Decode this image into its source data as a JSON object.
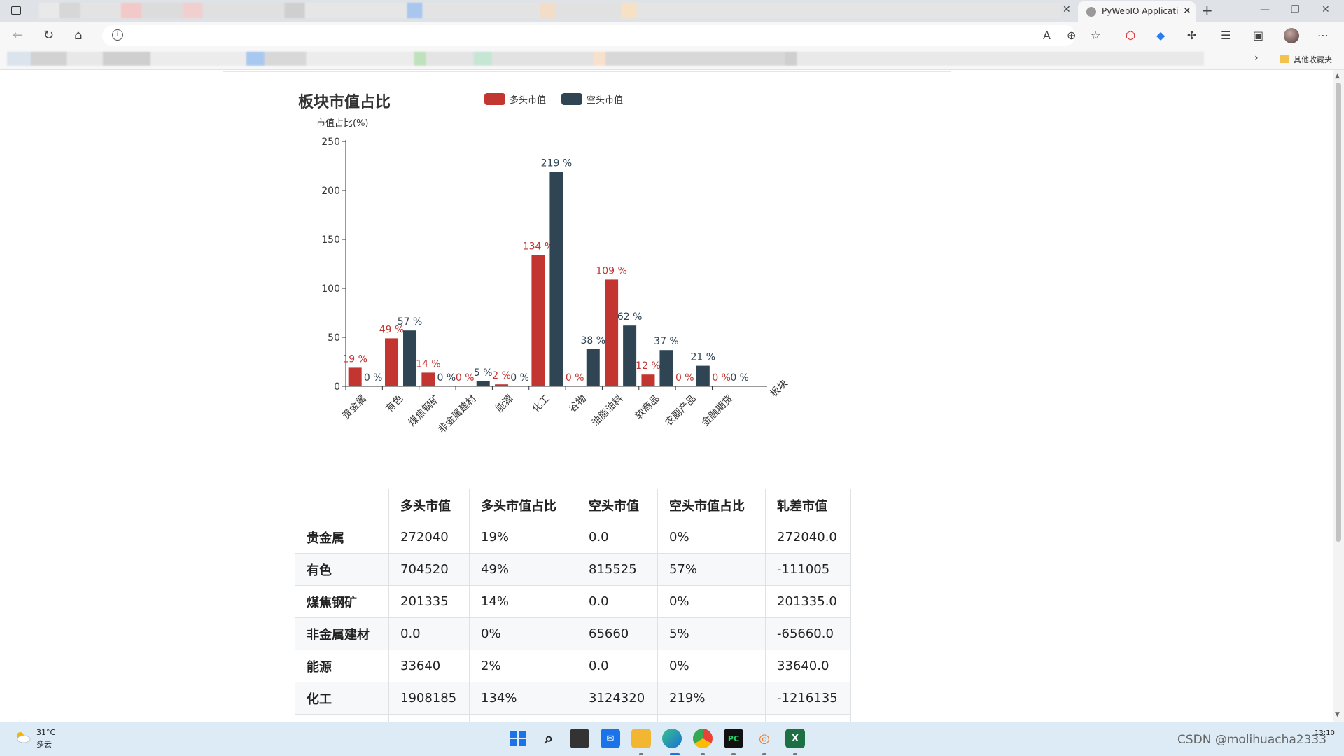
{
  "browser": {
    "active_tab_title": "PyWebIO Applicati",
    "new_tab_symbol": "+",
    "close_symbol": "✕",
    "bookmarks_folder": "其他收藏夹"
  },
  "chart": {
    "title": "板块市值占比",
    "legend": [
      {
        "name": "多头市值",
        "color": "#c23531"
      },
      {
        "name": "空头市值",
        "color": "#2f4554"
      }
    ]
  },
  "chart_data": {
    "type": "bar",
    "title": "板块市值占比",
    "ylabel": "市值占比(%)",
    "xlabel": "板块",
    "ylim": [
      0,
      250
    ],
    "yticks": [
      0,
      50,
      100,
      150,
      200,
      250
    ],
    "categories": [
      "贵金属",
      "有色",
      "煤焦钢矿",
      "非金属建材",
      "能源",
      "化工",
      "谷物",
      "油脂油料",
      "软商品",
      "农副产品",
      "金融期货"
    ],
    "series": [
      {
        "name": "多头市值",
        "color": "#c23531",
        "values": [
          19,
          49,
          14,
          0,
          2,
          134,
          0,
          109,
          12,
          0,
          0
        ]
      },
      {
        "name": "空头市值",
        "color": "#2f4554",
        "values": [
          0,
          57,
          0,
          5,
          0,
          219,
          38,
          62,
          37,
          21,
          0
        ]
      }
    ],
    "label_suffix": " %",
    "legend_position": "top"
  },
  "table": {
    "headers": [
      "",
      "多头市值",
      "多头市值占比",
      "空头市值",
      "空头市值占比",
      "轧差市值"
    ],
    "rows": [
      [
        "贵金属",
        "272040",
        "19%",
        "0.0",
        "0%",
        "272040.0"
      ],
      [
        "有色",
        "704520",
        "49%",
        "815525",
        "57%",
        "-111005"
      ],
      [
        "煤焦钢矿",
        "201335",
        "14%",
        "0.0",
        "0%",
        "201335.0"
      ],
      [
        "非金属建材",
        "0.0",
        "0%",
        "65660",
        "5%",
        "-65660.0"
      ],
      [
        "能源",
        "33640",
        "2%",
        "0.0",
        "0%",
        "33640.0"
      ],
      [
        "化工",
        "1908185",
        "134%",
        "3124320",
        "219%",
        "-1216135"
      ],
      [
        "",
        "",
        "",
        "",
        "",
        ""
      ]
    ]
  },
  "taskbar": {
    "weather_temp": "31°C",
    "weather_cond": "多云",
    "time": "13:10",
    "watermark": "CSDN @molihuacha2333"
  }
}
